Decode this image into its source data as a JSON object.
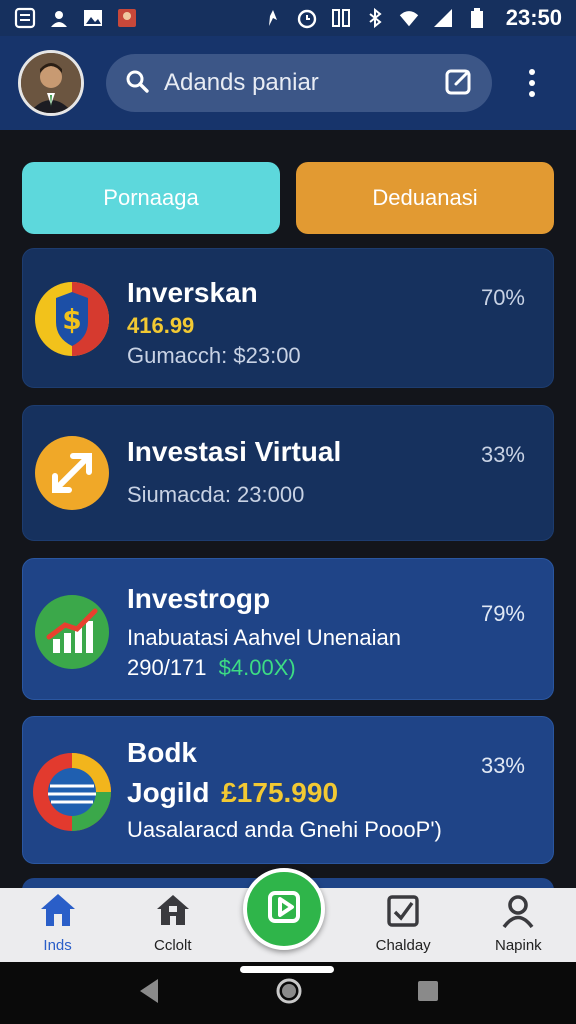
{
  "status_bar": {
    "time": "23:50"
  },
  "header": {
    "search_text": "Adands paniar"
  },
  "tabs": [
    {
      "label": "Pornaaga"
    },
    {
      "label": "Deduanasi"
    }
  ],
  "cards": [
    {
      "title": "Inverskan",
      "price": "416.99",
      "line": "Gumacch: $23:00",
      "percent": "70%"
    },
    {
      "title": "Investasi Virtual",
      "line": "Siumacda: 23:000",
      "percent": "33%"
    },
    {
      "title": "Investrogp",
      "line": "Inabuatasi Aahvel Unenaian",
      "line2_prefix": "290/171",
      "line2_value": "$4.00X)",
      "percent": "79%"
    },
    {
      "title": "Bodk",
      "title2": "Jogild",
      "price": "£175.990",
      "line": "Uasalaracd anda Gnehi PoooP')",
      "percent": "33%"
    }
  ],
  "bottom_nav": [
    {
      "label": "Inds",
      "icon": "home-icon"
    },
    {
      "label": "Cclolt",
      "icon": "house-icon"
    },
    {
      "label": "",
      "icon": "play-icon"
    },
    {
      "label": "Chalday",
      "icon": "checklist-icon"
    },
    {
      "label": "Napink",
      "icon": "user-icon"
    }
  ],
  "colors": {
    "tab_primary": "#5dd8dc",
    "tab_secondary": "#e29a32",
    "price": "#f2c933",
    "green_value": "#3ddc84",
    "fab": "#2fb54a",
    "active_nav": "#2a5ec8"
  }
}
